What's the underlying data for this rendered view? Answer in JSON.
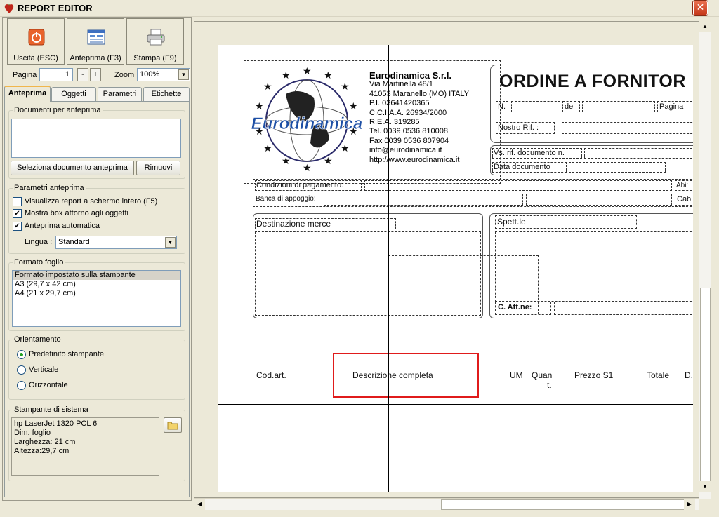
{
  "window": {
    "title": "REPORT EDITOR",
    "close_label": "✕"
  },
  "toolbar": {
    "exit_label": "Uscita (ESC)",
    "preview_label": "Anteprima (F3)",
    "print_label": "Stampa (F9)"
  },
  "pager": {
    "page_label": "Pagina",
    "page_value": "1",
    "minus": "-",
    "plus": "+",
    "zoom_label": "Zoom",
    "zoom_value": "100%"
  },
  "tabs": [
    "Anteprima",
    "Oggetti",
    "Parametri",
    "Etichette"
  ],
  "documents": {
    "title": "Documenti per anteprima",
    "select_button": "Seleziona documento anteprima",
    "remove_button": "Rimuovi"
  },
  "params": {
    "title": "Parametri anteprima",
    "fullscreen": "Visualizza report a schermo intero (F5)",
    "show_box": "Mostra box attorno agli oggetti",
    "auto_preview": "Anteprima automatica",
    "language_label": "Lingua :",
    "language_value": "Standard"
  },
  "format": {
    "title": "Formato foglio",
    "items": [
      "Formato impostato sulla stampante",
      "A3 (29,7 x 42 cm)",
      "A4 (21 x 29,7 cm)"
    ]
  },
  "orientation": {
    "title": "Orientamento",
    "options": [
      "Predefinito stampante",
      "Verticale",
      "Orizzontale"
    ]
  },
  "printer": {
    "title": "Stampante di sistema",
    "lines": [
      "hp LaserJet 1320 PCL 6",
      "Dim. foglio",
      "Larghezza: 21 cm",
      "Altezza:29,7 cm"
    ]
  },
  "report": {
    "company_name": "Eurodinamica S.r.l.",
    "company_lines": [
      "Via Martinella 48/1",
      "41053 Maranello (MO) ITALY",
      "P.I. 03641420365",
      "C.C.I.A.A. 26934/2000",
      "R.E.A. 319285",
      "Tel. 0039 0536 810008",
      "Fax 0039 0536 807904",
      "info@eurodinamica.it",
      "http://www.eurodinamica.it"
    ],
    "logo_text": "Eurodinamica",
    "order_title": "ORDINE A FORNITOR",
    "n_label": "N.",
    "del_label": "del",
    "pagina_label": "Pagina",
    "nostro_rif": "Nostro Rif. :",
    "vs_rif": "Vs. rif. documento n.",
    "data_doc": "Data documento",
    "cond_pag": "Condizioni di pagamento:",
    "banca": "Banca di appoggio:",
    "abi": "Abi:",
    "cab": "Cab",
    "destinazione": "Destinazione merce",
    "spett": "Spett.le",
    "c_att": "C. Att.ne:",
    "col_codart": "Cod.art.",
    "col_descr": "Descrizione completa",
    "col_um": "UM",
    "col_quant": "Quan",
    "col_quant2": "t.",
    "col_prezzo": "Prezzo S1",
    "col_totale": "Totale",
    "col_d": "D."
  }
}
